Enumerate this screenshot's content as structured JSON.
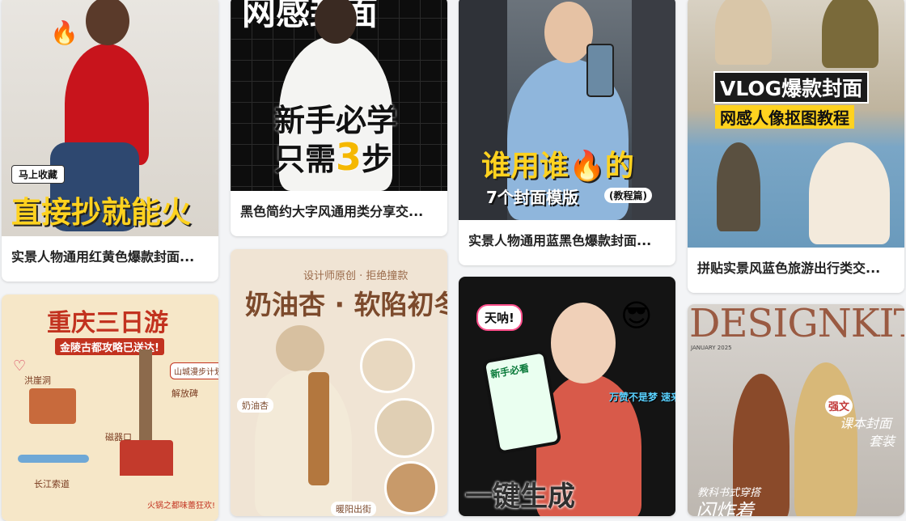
{
  "cards": [
    {
      "title": "实景人物通用红黄色爆款封面...",
      "overlay": {
        "badge": "马上收藏",
        "headline": "直接抄就能火",
        "emoji": "🔥"
      }
    },
    {
      "title": "黑色简约大字风通用类分享交...",
      "overlay": {
        "top": "网感封面",
        "line1": "新手必学",
        "line2a": "只需",
        "line2b": "3",
        "line2c": "步"
      }
    },
    {
      "title": "实景人物通用蓝黑色爆款封面...",
      "overlay": {
        "line1a": "谁用谁",
        "emoji": "🔥",
        "line1b": "的",
        "line2": "7个封面模版",
        "tag": "(教程篇)"
      }
    },
    {
      "title": "拼贴实景风蓝色旅游出行类交...",
      "overlay": {
        "line1": "VLOG爆款封面",
        "line2": "网感人像抠图教程"
      }
    },
    {
      "title": "",
      "overlay": {
        "title": "重庆三日游",
        "subtitle": "金陵古都攻略已送达!",
        "labels": [
          "洪崖洞",
          "山城漫步计划启动!",
          "解放碑",
          "磁器口",
          "长江索道",
          "火锅之都味蕾狂欢!"
        ],
        "heart": "♡"
      }
    },
    {
      "title": "",
      "overlay": {
        "top": "设计师原创 · 拒绝撞款",
        "headline": "奶油杏 · 软陷初冬",
        "tag1": "奶油杏",
        "tag2": "暖阳出街"
      }
    },
    {
      "title": "",
      "overlay": {
        "bubble": "天呐!",
        "phone_top": "新手必看",
        "side": "万赞不是梦 速来围观",
        "bottom": "一键生成",
        "emoji": "😎"
      }
    },
    {
      "title": "",
      "overlay": {
        "brand": "DESIGNKIT",
        "date": "JANUARY 2025",
        "tag": "强文",
        "right1": "课本封面",
        "right2": "套装",
        "bottom1": "教科书式穿搭",
        "bottom2": "闪炸着"
      }
    }
  ],
  "colors": {
    "accent_yellow": "#ffd21f",
    "card_bg": "#ffffff",
    "page_bg": "#f3f4f6"
  }
}
